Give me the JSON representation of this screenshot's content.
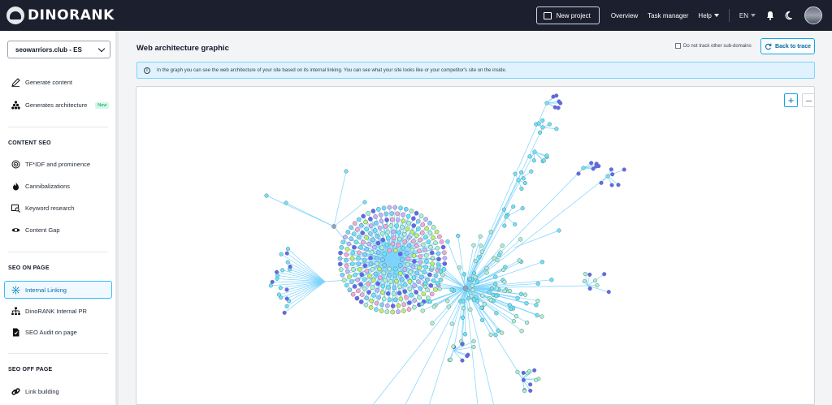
{
  "header": {
    "logo_text": "DINORANK",
    "new_project_label": "New project",
    "nav": {
      "overview": "Overview",
      "task_manager": "Task manager",
      "help": "Help",
      "language": "EN"
    }
  },
  "sidebar": {
    "site_select": "seowarriors.club - ES",
    "top_items": [
      {
        "label": "Generate content",
        "icon": "pen-icon"
      },
      {
        "label": "Generates architecture",
        "icon": "hierarchy-icon",
        "badge": "New"
      }
    ],
    "sections": [
      {
        "title": "CONTENT SEO",
        "items": [
          {
            "label": "TF*IDF and prominence",
            "icon": "target-icon"
          },
          {
            "label": "Cannibalizations",
            "icon": "fire-icon"
          },
          {
            "label": "Keyword research",
            "icon": "keyword-icon"
          },
          {
            "label": "Content Gap",
            "icon": "eye-icon"
          }
        ]
      },
      {
        "title": "SEO ON PAGE",
        "items": [
          {
            "label": "Internal Linking",
            "icon": "network-icon",
            "active": true
          },
          {
            "label": "DinoRANK Internal PR",
            "icon": "hierarchy-icon"
          },
          {
            "label": "SEO Audit on page",
            "icon": "document-icon"
          }
        ]
      },
      {
        "title": "SEO OFF PAGE",
        "items": [
          {
            "label": "Link building",
            "icon": "link-icon"
          }
        ]
      }
    ]
  },
  "main": {
    "title": "Web architecture graphic",
    "subdomain_checkbox_label": "Do not track other sub-domains",
    "subdomain_checked": false,
    "back_button_label": "Back to trace",
    "info_text": "In the graph you can see the web architecture of your site based on its internal linking. You can see what your site looks like or your competitor's site on the inside.",
    "zoom_in_label": "+",
    "zoom_out_label": "–"
  },
  "colors": {
    "topbar": "#1c1f2e",
    "accent": "#0ea5e9",
    "node_cyan": "#67e8f9",
    "node_green": "#a7f3d0",
    "node_blue": "#6366f1",
    "edge": "#7dd3fc"
  }
}
